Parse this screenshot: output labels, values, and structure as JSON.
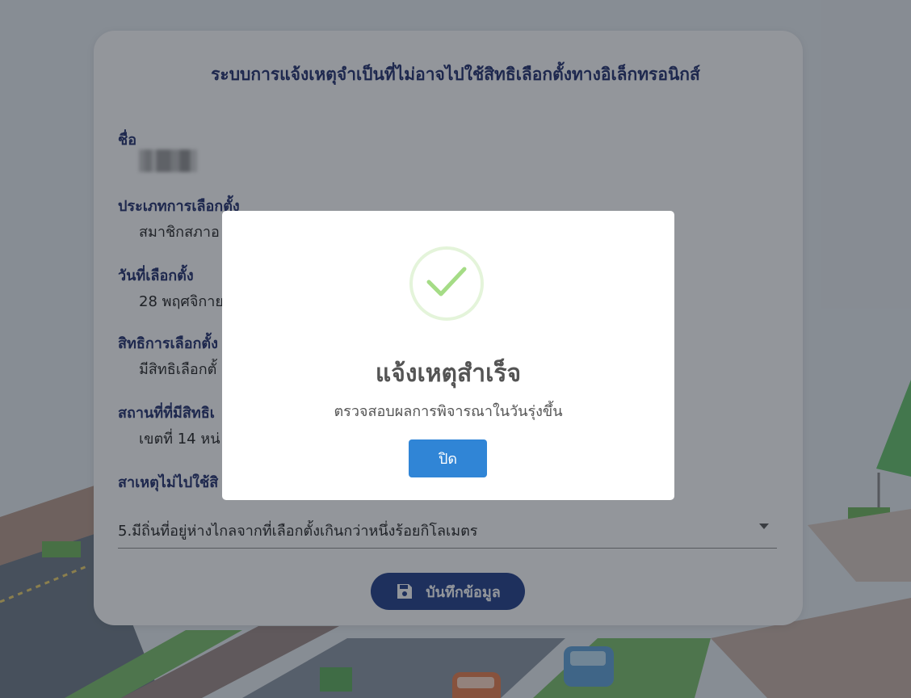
{
  "form": {
    "title": "ระบบการแจ้งเหตุจำเป็นที่ไม่อาจไปใช้สิทธิเลือกตั้งทางอิเล็กทรอนิกส์",
    "name_label": "ชื่อ",
    "election_type_label": "ประเภทการเลือกตั้ง",
    "election_type_value": "สมาชิกสภาอ",
    "election_date_label": "วันที่เลือกตั้ง",
    "election_date_value": "28 พฤศจิกาย",
    "right_label": "สิทธิการเลือกตั้ง",
    "right_value": "มีสิทธิเลือกตั้",
    "place_label": "สถานที่ที่มีสิทธิเ",
    "place_value": "เขตที่ 14 หน่",
    "reason_label": "สาเหตุไม่ไปใช้สิ",
    "reason_selected": "5.มีถิ่นที่อยู่ห่างไกลจากที่เลือกตั้งเกินกว่าหนึ่งร้อยกิโลเมตร",
    "save_label": "บันทึกข้อมูล"
  },
  "modal": {
    "title": "แจ้งเหตุสำเร็จ",
    "message": "ตรวจสอบผลการพิจารณาในวันรุ่งขึ้น",
    "close_label": "ปิด"
  },
  "colors": {
    "primary_navy": "#1f3c88",
    "heading_navy": "#1f2d6b",
    "modal_button": "#3085d6",
    "success_green": "#a5dc86"
  }
}
